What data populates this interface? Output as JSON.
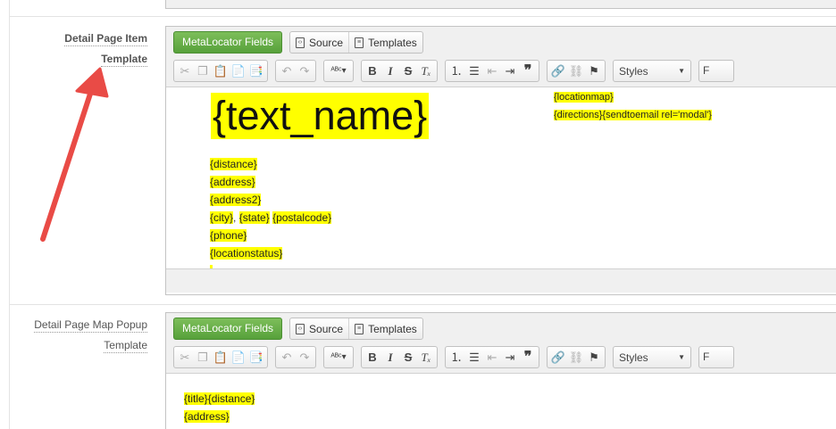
{
  "field1": {
    "label_line1": "Detail Page Item",
    "label_line2": "Template",
    "toolbar": {
      "metalocator_fields": "MetaLocator Fields",
      "source": "Source",
      "templates": "Templates",
      "styles": "Styles",
      "format": "F"
    },
    "content": {
      "name_tag": "{text_name}",
      "lines": [
        "{distance}",
        "{address}",
        "{address2}",
        "{phone}",
        "{locationstatus}"
      ],
      "city_parts": [
        "{city}",
        ", ",
        "{state}",
        " ",
        "{postalcode}"
      ],
      "right_lines": [
        "{locationmap}",
        "{directions}{sendtoemail rel='modal'}"
      ]
    }
  },
  "field2": {
    "label_line1": "Detail Page Map Popup",
    "label_line2": "Template",
    "toolbar": {
      "metalocator_fields": "MetaLocator Fields",
      "source": "Source",
      "templates": "Templates",
      "styles": "Styles",
      "format": "F"
    },
    "content": {
      "lines": [
        "{title}{distance}",
        "{address}"
      ]
    }
  },
  "colors": {
    "highlight": "#ffff00",
    "button_green": "#5ea544",
    "arrow_red": "#e94b46"
  },
  "icons": {
    "cut": "scissors-icon",
    "copy": "copy-icon",
    "paste": "paste-icon",
    "paste_text": "paste-text-icon",
    "paste_word": "paste-word-icon",
    "undo": "undo-icon",
    "redo": "redo-icon",
    "spellcheck": "spellcheck-icon",
    "bold": "bold-icon",
    "italic": "italic-icon",
    "strike": "strikethrough-icon",
    "remove_format": "remove-format-icon",
    "numbered_list": "numbered-list-icon",
    "bulleted_list": "bulleted-list-icon",
    "outdent": "outdent-icon",
    "indent": "indent-icon",
    "blockquote": "blockquote-icon",
    "link": "link-icon",
    "unlink": "unlink-icon",
    "anchor": "anchor-flag-icon"
  }
}
